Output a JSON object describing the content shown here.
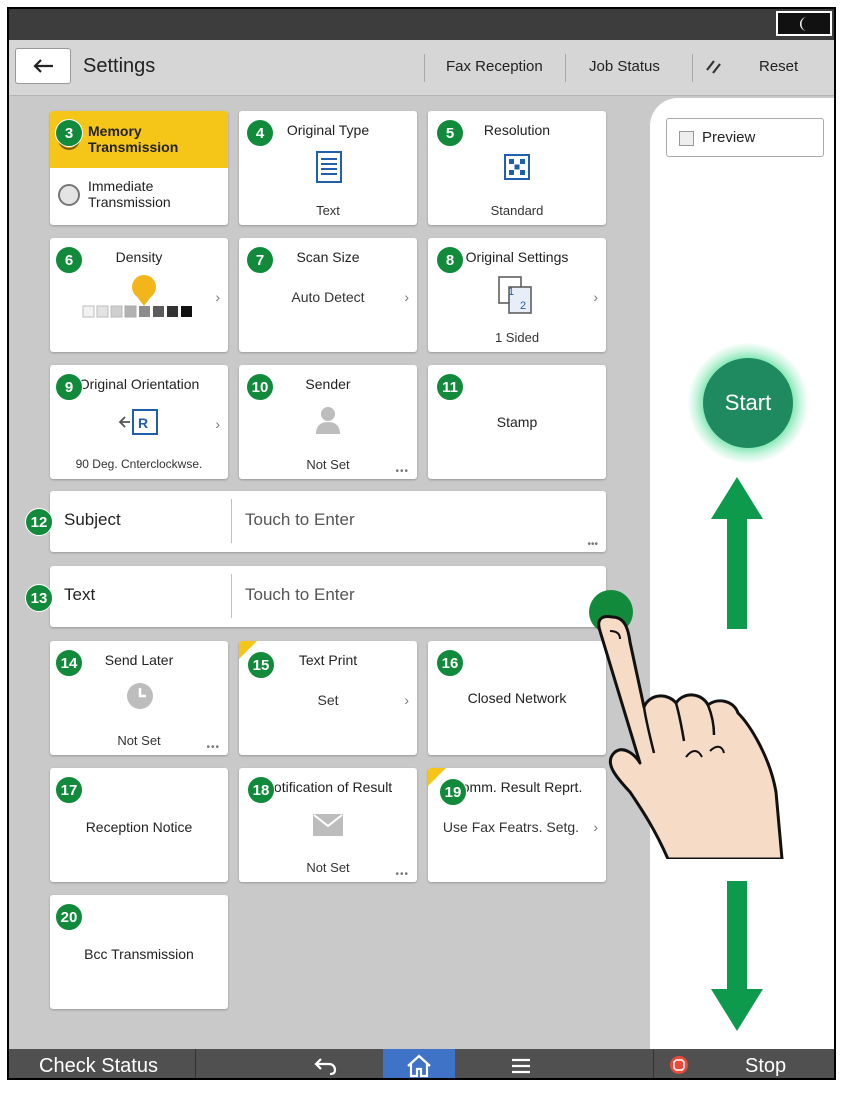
{
  "header": {
    "title": "Settings",
    "fax_reception": "Fax Reception",
    "job_status": "Job Status",
    "reset": "Reset"
  },
  "transmission": {
    "memory": "Memory\nTransmission",
    "immediate": "Immediate\nTransmission"
  },
  "cards": {
    "original_type": {
      "label": "Original Type",
      "value": "Text"
    },
    "resolution": {
      "label": "Resolution",
      "value": "Standard"
    },
    "density": {
      "label": "Density"
    },
    "scan_size": {
      "label": "Scan Size",
      "value": "Auto Detect"
    },
    "original_settings": {
      "label": "Original Settings",
      "value": "1 Sided"
    },
    "original_orientation": {
      "label": "Original Orientation",
      "value": "90 Deg. Cnterclockwse."
    },
    "sender": {
      "label": "Sender",
      "value": "Not Set"
    },
    "stamp": {
      "label": "Stamp"
    },
    "send_later": {
      "label": "Send Later",
      "value": "Not Set"
    },
    "text_print": {
      "label": "Text Print",
      "value": "Set"
    },
    "closed_network": {
      "label": "Closed Network"
    },
    "reception_notice": {
      "label": "Reception Notice"
    },
    "notification_of_result": {
      "label": "Notification of Result",
      "value": "Not Set"
    },
    "comm_result_report": {
      "label": "Comm. Result Reprt.",
      "value": "Use Fax Featrs. Setg."
    },
    "bcc_transmission": {
      "label": "Bcc Transmission"
    }
  },
  "subject": {
    "label": "Subject",
    "value": "Touch to Enter"
  },
  "text_field": {
    "label": "Text",
    "value": "Touch to Enter"
  },
  "preview": {
    "label": "Preview"
  },
  "start": {
    "label": "Start"
  },
  "bottom": {
    "check_status": "Check Status",
    "stop": "Stop"
  },
  "badges": {
    "memory": "3",
    "original_type": "4",
    "resolution": "5",
    "density": "6",
    "scan_size": "7",
    "original_settings": "8",
    "original_orientation": "9",
    "sender": "10",
    "stamp": "11",
    "subject": "12",
    "text": "13",
    "send_later": "14",
    "text_print": "15",
    "closed_network": "16",
    "reception_notice": "17",
    "notification_of_result": "18",
    "comm_result_report": "19",
    "bcc_transmission": "20"
  },
  "colors": {
    "accent_yellow": "#f5c518",
    "badge_green": "#118b3b",
    "start_green": "#1f8a60",
    "arrow_green": "#0e9a4c",
    "home_blue": "#3f73c8",
    "density_marker": "#f2b61b"
  },
  "icons": {
    "back": "arrow-left-icon",
    "moon": "moon-icon",
    "reset": "reset-icon",
    "undo": "return-icon",
    "home": "home-icon",
    "menu": "menu-icon",
    "stop": "stop-icon"
  }
}
